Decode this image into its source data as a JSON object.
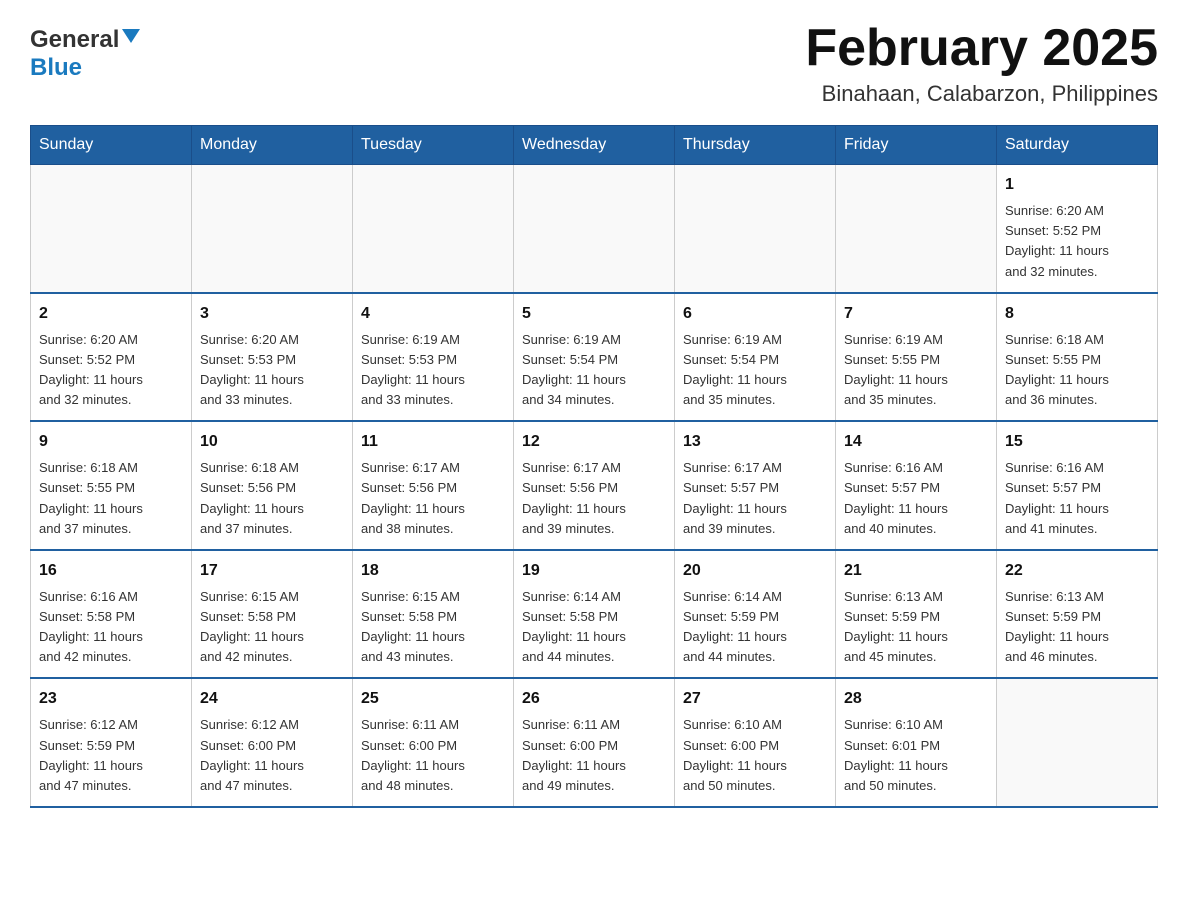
{
  "header": {
    "logo_general": "General",
    "logo_blue": "Blue",
    "title": "February 2025",
    "subtitle": "Binahaan, Calabarzon, Philippines"
  },
  "days_of_week": [
    "Sunday",
    "Monday",
    "Tuesday",
    "Wednesday",
    "Thursday",
    "Friday",
    "Saturday"
  ],
  "weeks": [
    [
      {
        "day": "",
        "info": ""
      },
      {
        "day": "",
        "info": ""
      },
      {
        "day": "",
        "info": ""
      },
      {
        "day": "",
        "info": ""
      },
      {
        "day": "",
        "info": ""
      },
      {
        "day": "",
        "info": ""
      },
      {
        "day": "1",
        "info": "Sunrise: 6:20 AM\nSunset: 5:52 PM\nDaylight: 11 hours\nand 32 minutes."
      }
    ],
    [
      {
        "day": "2",
        "info": "Sunrise: 6:20 AM\nSunset: 5:52 PM\nDaylight: 11 hours\nand 32 minutes."
      },
      {
        "day": "3",
        "info": "Sunrise: 6:20 AM\nSunset: 5:53 PM\nDaylight: 11 hours\nand 33 minutes."
      },
      {
        "day": "4",
        "info": "Sunrise: 6:19 AM\nSunset: 5:53 PM\nDaylight: 11 hours\nand 33 minutes."
      },
      {
        "day": "5",
        "info": "Sunrise: 6:19 AM\nSunset: 5:54 PM\nDaylight: 11 hours\nand 34 minutes."
      },
      {
        "day": "6",
        "info": "Sunrise: 6:19 AM\nSunset: 5:54 PM\nDaylight: 11 hours\nand 35 minutes."
      },
      {
        "day": "7",
        "info": "Sunrise: 6:19 AM\nSunset: 5:55 PM\nDaylight: 11 hours\nand 35 minutes."
      },
      {
        "day": "8",
        "info": "Sunrise: 6:18 AM\nSunset: 5:55 PM\nDaylight: 11 hours\nand 36 minutes."
      }
    ],
    [
      {
        "day": "9",
        "info": "Sunrise: 6:18 AM\nSunset: 5:55 PM\nDaylight: 11 hours\nand 37 minutes."
      },
      {
        "day": "10",
        "info": "Sunrise: 6:18 AM\nSunset: 5:56 PM\nDaylight: 11 hours\nand 37 minutes."
      },
      {
        "day": "11",
        "info": "Sunrise: 6:17 AM\nSunset: 5:56 PM\nDaylight: 11 hours\nand 38 minutes."
      },
      {
        "day": "12",
        "info": "Sunrise: 6:17 AM\nSunset: 5:56 PM\nDaylight: 11 hours\nand 39 minutes."
      },
      {
        "day": "13",
        "info": "Sunrise: 6:17 AM\nSunset: 5:57 PM\nDaylight: 11 hours\nand 39 minutes."
      },
      {
        "day": "14",
        "info": "Sunrise: 6:16 AM\nSunset: 5:57 PM\nDaylight: 11 hours\nand 40 minutes."
      },
      {
        "day": "15",
        "info": "Sunrise: 6:16 AM\nSunset: 5:57 PM\nDaylight: 11 hours\nand 41 minutes."
      }
    ],
    [
      {
        "day": "16",
        "info": "Sunrise: 6:16 AM\nSunset: 5:58 PM\nDaylight: 11 hours\nand 42 minutes."
      },
      {
        "day": "17",
        "info": "Sunrise: 6:15 AM\nSunset: 5:58 PM\nDaylight: 11 hours\nand 42 minutes."
      },
      {
        "day": "18",
        "info": "Sunrise: 6:15 AM\nSunset: 5:58 PM\nDaylight: 11 hours\nand 43 minutes."
      },
      {
        "day": "19",
        "info": "Sunrise: 6:14 AM\nSunset: 5:58 PM\nDaylight: 11 hours\nand 44 minutes."
      },
      {
        "day": "20",
        "info": "Sunrise: 6:14 AM\nSunset: 5:59 PM\nDaylight: 11 hours\nand 44 minutes."
      },
      {
        "day": "21",
        "info": "Sunrise: 6:13 AM\nSunset: 5:59 PM\nDaylight: 11 hours\nand 45 minutes."
      },
      {
        "day": "22",
        "info": "Sunrise: 6:13 AM\nSunset: 5:59 PM\nDaylight: 11 hours\nand 46 minutes."
      }
    ],
    [
      {
        "day": "23",
        "info": "Sunrise: 6:12 AM\nSunset: 5:59 PM\nDaylight: 11 hours\nand 47 minutes."
      },
      {
        "day": "24",
        "info": "Sunrise: 6:12 AM\nSunset: 6:00 PM\nDaylight: 11 hours\nand 47 minutes."
      },
      {
        "day": "25",
        "info": "Sunrise: 6:11 AM\nSunset: 6:00 PM\nDaylight: 11 hours\nand 48 minutes."
      },
      {
        "day": "26",
        "info": "Sunrise: 6:11 AM\nSunset: 6:00 PM\nDaylight: 11 hours\nand 49 minutes."
      },
      {
        "day": "27",
        "info": "Sunrise: 6:10 AM\nSunset: 6:00 PM\nDaylight: 11 hours\nand 50 minutes."
      },
      {
        "day": "28",
        "info": "Sunrise: 6:10 AM\nSunset: 6:01 PM\nDaylight: 11 hours\nand 50 minutes."
      },
      {
        "day": "",
        "info": ""
      }
    ]
  ]
}
